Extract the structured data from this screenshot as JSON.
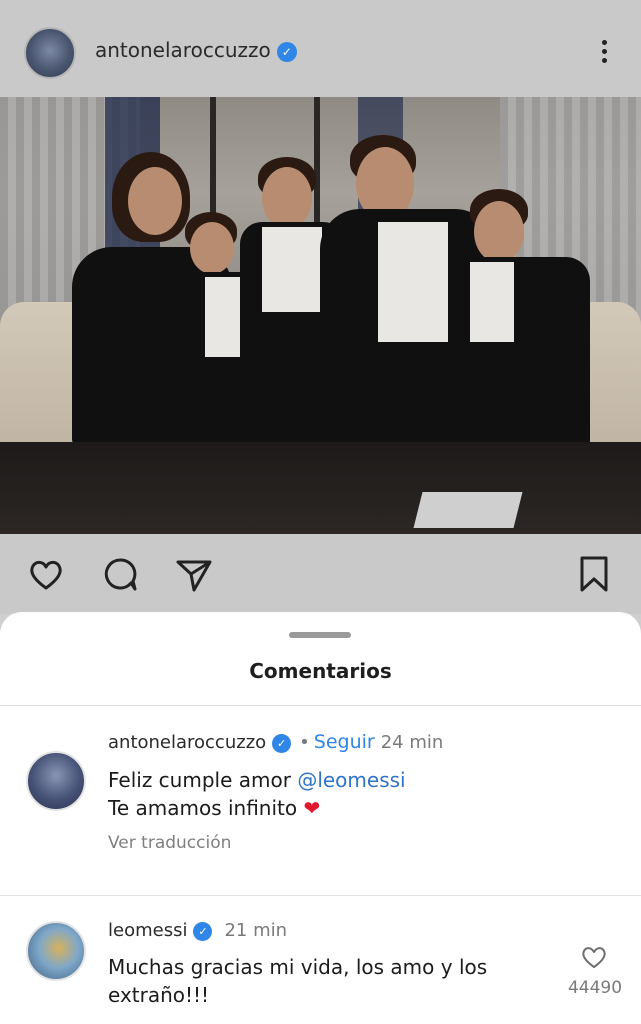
{
  "post": {
    "username": "antonelaroccuzzo",
    "verified_mark": "✓",
    "more_icon": "more-vertical-icon"
  },
  "actions": {
    "icons": [
      "heart-icon",
      "comment-icon",
      "share-icon",
      "bookmark-icon"
    ]
  },
  "sheet": {
    "title": "Comentarios"
  },
  "comments": [
    {
      "username": "antonelaroccuzzo",
      "verified_mark": "✓",
      "dot": "•",
      "follow_label": "Seguir",
      "time": "24 min",
      "text_line1_prefix": "Feliz cumple amor ",
      "mention": "@leomessi",
      "text_line2": "Te amamos infinito ",
      "emoji": "❤",
      "translate_label": "Ver traducción"
    },
    {
      "username": "leomessi",
      "verified_mark": "✓",
      "time": "21 min",
      "text_line1": "Muchas gracias mi vida, los amo y los",
      "text_line2": "extraño!!!",
      "like_count": "44490"
    }
  ],
  "colors": {
    "accent": "#2f86e6",
    "mention": "#2f74c8",
    "heart": "#e0192e"
  }
}
